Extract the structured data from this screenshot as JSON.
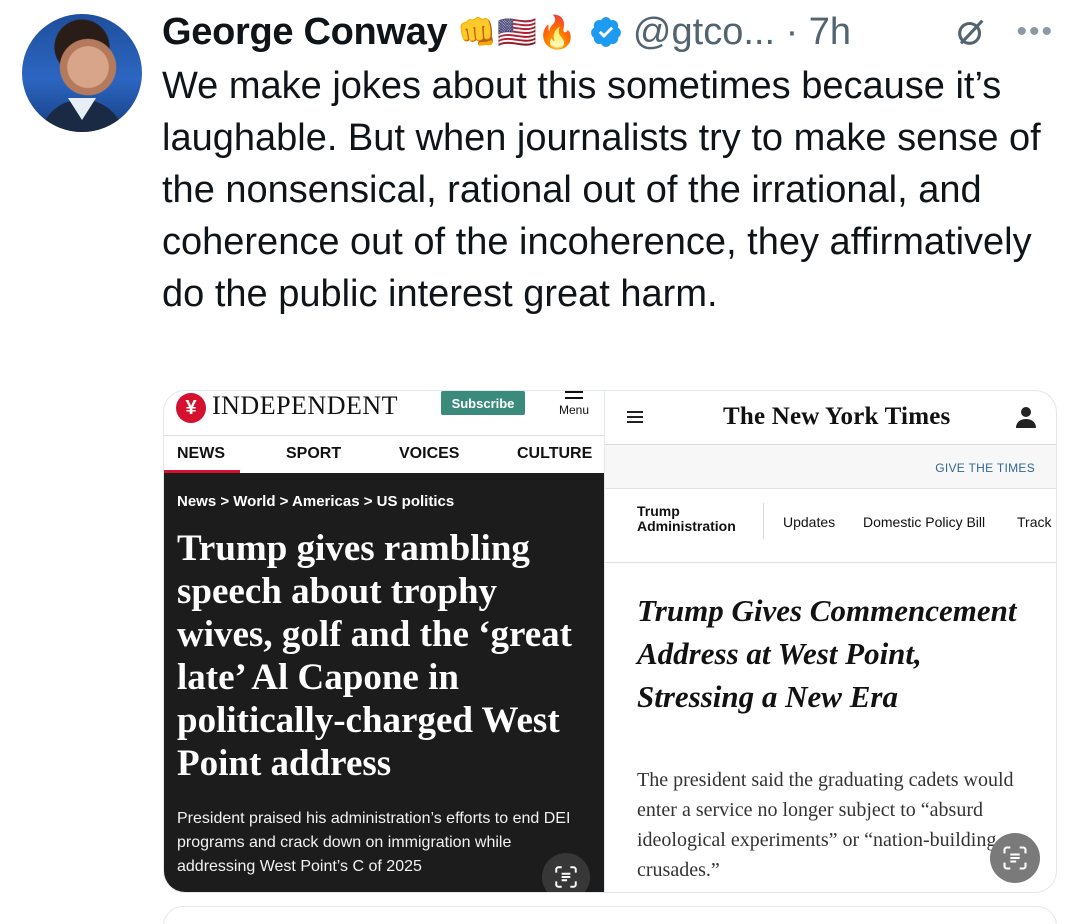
{
  "tweet": {
    "author_name": "George Conway",
    "author_emojis": "👊🇺🇸🔥",
    "handle": "@gtco...",
    "separator": "·",
    "time": "7h",
    "text": "We make jokes about this sometimes because it’s laughable.  But when journalists try to make sense of the nonsensical, rational out of the irrational, and coherence out of the incoherence, they affirmatively do the public interest great harm."
  },
  "colors": {
    "verified_blue": "#1d9bf0",
    "independent_red": "#d6102f",
    "independent_subscribe": "#3a8b7b",
    "independent_dark": "#1c1c1c",
    "nyt_link": "#326891"
  },
  "icons": {
    "verified": "verified-badge-icon",
    "grok": "grok-icon",
    "more": "more-options-icon",
    "scan": "visual-lookup-icon",
    "hamburger": "hamburger-menu-icon",
    "account": "account-icon"
  },
  "independent": {
    "logo_mark": "¥",
    "logo_text": "INDEPENDENT",
    "subscribe_label": "Subscribe",
    "menu_label": "Menu",
    "nav": [
      "NEWS",
      "SPORT",
      "VOICES",
      "CULTURE"
    ],
    "breadcrumb": "News > World > Americas > US politics",
    "headline": "Trump gives rambling speech about trophy wives, golf and the ‘great late’ Al Capone in politically-charged West Point address",
    "standfirst": "President praised his administration’s efforts to end DEI programs and crack down on immigration while addressing West Point’s C of 2025"
  },
  "nyt": {
    "logo_text": "The New York Times",
    "give_label": "GIVE THE TIMES",
    "section": "Trump Administration",
    "subnav": [
      "Updates",
      "Domestic Policy Bill",
      "Track"
    ],
    "headline": "Trump Gives Commencement Address at West Point, Stressing a New Era",
    "summary": "The president said the graduating cadets would enter a service no longer subject to “absurd ideological experiments” or “nation-building crusades.”"
  }
}
